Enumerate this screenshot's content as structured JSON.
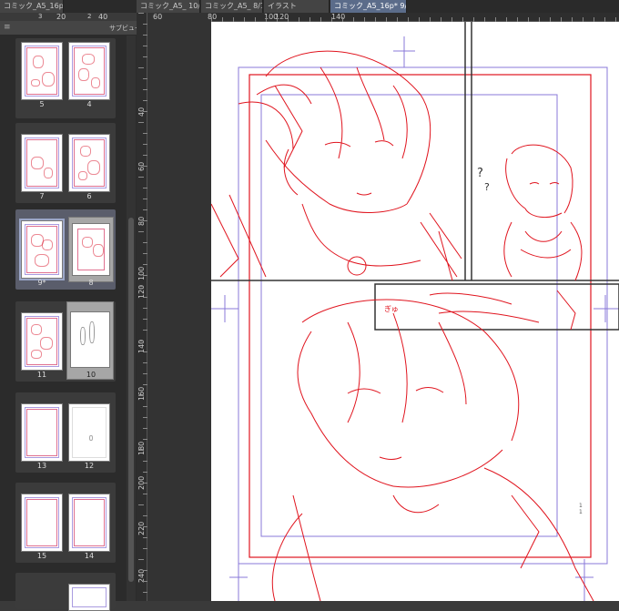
{
  "tabs": [
    {
      "label": "コミック_A5_16p..."
    },
    {
      "label": "コミック_A5_ 10/16"
    },
    {
      "label": "コミック_A5_ 8/16"
    },
    {
      "label": "イラスト"
    },
    {
      "label": "コミック_A5_16p* 9/16",
      "close": "×"
    }
  ],
  "top_strip": {
    "left_num": "3",
    "right_num": "2"
  },
  "subview": {
    "menu_icon": "≡",
    "title": "サブビュー",
    "minimize": "—",
    "close": "□"
  },
  "spreads": [
    {
      "left": "5",
      "right": "4"
    },
    {
      "left": "7",
      "right": "6"
    },
    {
      "left": "9*",
      "right": "8"
    },
    {
      "left": "11",
      "right": "10"
    },
    {
      "left": "13",
      "right": "12"
    },
    {
      "left": "15",
      "right": "14"
    }
  ],
  "vruler_labels": [
    "40",
    "60",
    "80",
    "100",
    "120",
    "140",
    "160",
    "180",
    "200",
    "220",
    "240"
  ],
  "hruler_labels": [
    "20",
    "40",
    "60",
    "80",
    "100",
    "120",
    "140"
  ],
  "canvas": {
    "side_note": "1\n1",
    "question_mark": "?",
    "sfx_text": "ぎゅ"
  },
  "colors": {
    "sketch_red": "#e0141e",
    "guide_purple": "#8878d8",
    "panel_border": "#333333",
    "active_tab": "#5b6c8a"
  }
}
